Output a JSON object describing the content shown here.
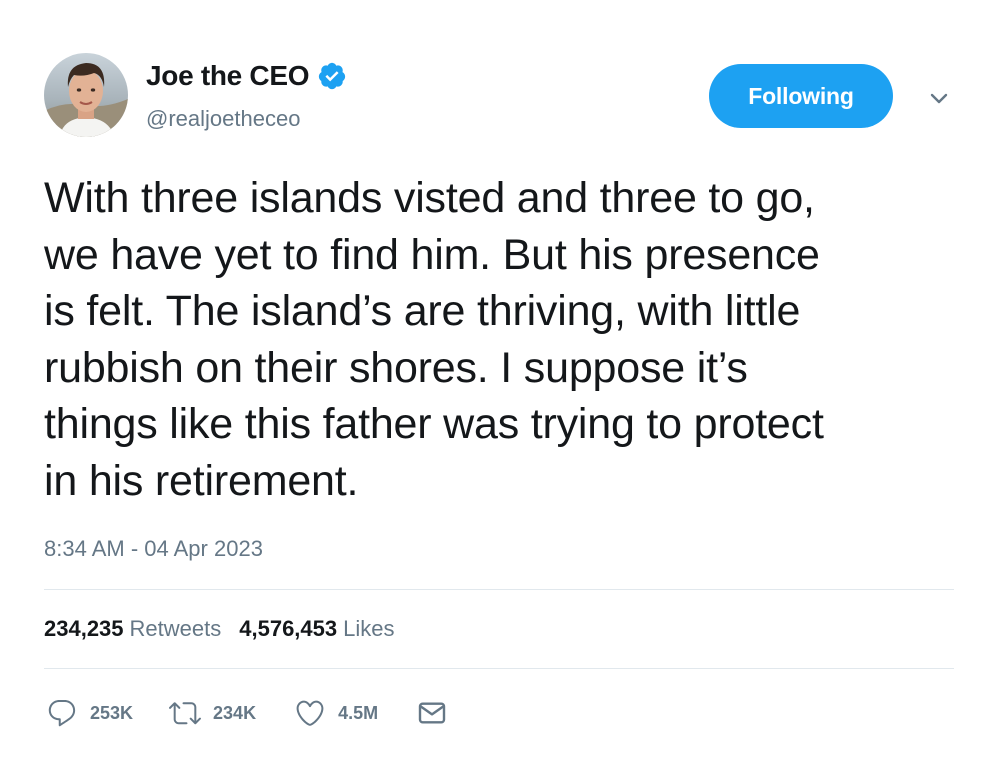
{
  "user": {
    "display_name": "Joe the CEO",
    "handle": "@realjoetheceo",
    "verified": true,
    "follow_label": "Following"
  },
  "tweet": {
    "text": "With three islands visted and three to go,\nwe have yet to find him. But his presence\nis felt. The island’s are thriving, with little\nrubbish on their shores. I suppose it’s\nthings like this father was trying to protect\nin his retirement.",
    "timestamp": "8:34 AM - 04 Apr 2023"
  },
  "stats": {
    "retweets_count": "234,235",
    "retweets_label": "Retweets",
    "likes_count": "4,576,453",
    "likes_label": "Likes"
  },
  "actions": {
    "reply_count": "253K",
    "retweet_count": "234K",
    "like_count": "4.5M"
  },
  "icons": {
    "verified": "verified-badge-icon",
    "menu": "chevron-down-icon",
    "reply": "reply-icon",
    "retweet": "retweet-icon",
    "like": "heart-icon",
    "dm": "envelope-icon"
  },
  "colors": {
    "accent": "#1da1f2",
    "text_primary": "#14171a",
    "text_secondary": "#657786",
    "divider": "#e1e8ed"
  }
}
